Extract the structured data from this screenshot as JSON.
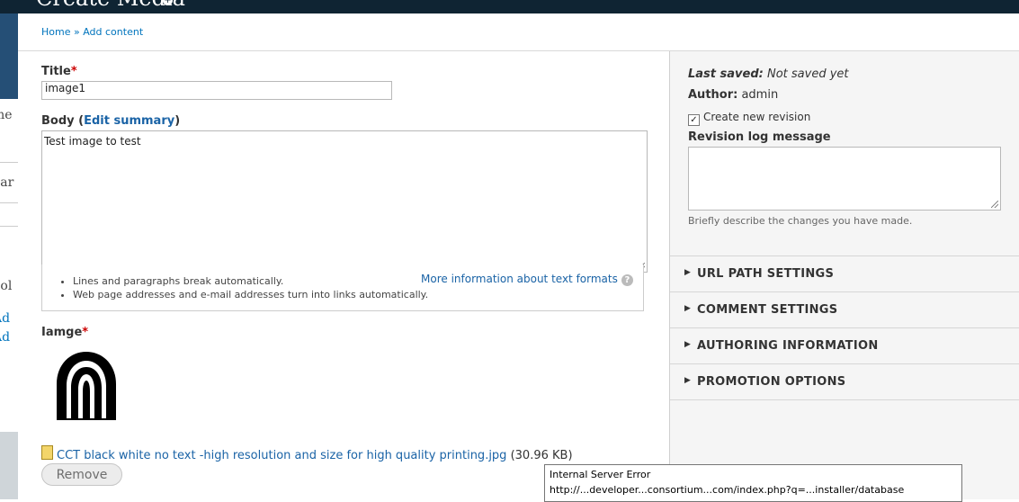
{
  "header": {
    "title": "Create Media",
    "shortcut_icon": "plus-circle-icon"
  },
  "behind_page": {
    "texts": [
      "me",
      "ear",
      "ool",
      "Ad",
      "Ad"
    ]
  },
  "breadcrumb": {
    "home": "Home",
    "separator": "»",
    "current": "Add content"
  },
  "form": {
    "title_label": "Title",
    "required_marker": "*",
    "title_value": "image1",
    "body_label_prefix": "Body (",
    "body_edit_summary": "Edit summary",
    "body_label_suffix": ")",
    "body_value": "Test image to test",
    "format_tips": [
      "Lines and paragraphs break automatically.",
      "Web page addresses and e-mail addresses turn into links automatically."
    ],
    "format_more_link": "More information about text formats",
    "help_icon_glyph": "?",
    "image_label": "Iamge",
    "file_name": "CCT black white no text -high resolution and size for high quality printing.jpg",
    "file_size": "(30.96 KB)",
    "remove_button": "Remove"
  },
  "sidebar": {
    "last_saved_label": "Last saved:",
    "last_saved_value": "Not saved yet",
    "author_label": "Author:",
    "author_value": "admin",
    "create_revision_label": "Create new revision",
    "create_revision_checked": true,
    "revision_log_label": "Revision log message",
    "revision_log_value": "",
    "revision_log_hint": "Briefly describe the changes you have made.",
    "sections": [
      "URL PATH SETTINGS",
      "COMMENT SETTINGS",
      "AUTHORING INFORMATION",
      "PROMOTION OPTIONS"
    ]
  },
  "tooltip": {
    "line1": "Internal Server Error",
    "line2": "http://...developer...consortium...com/index.php?q=...installer/database"
  },
  "colors": {
    "header_bg": "#0f2433",
    "link": "#1a63a6",
    "required": "#cc0000",
    "sidebar_bg": "#f5f5f5"
  }
}
